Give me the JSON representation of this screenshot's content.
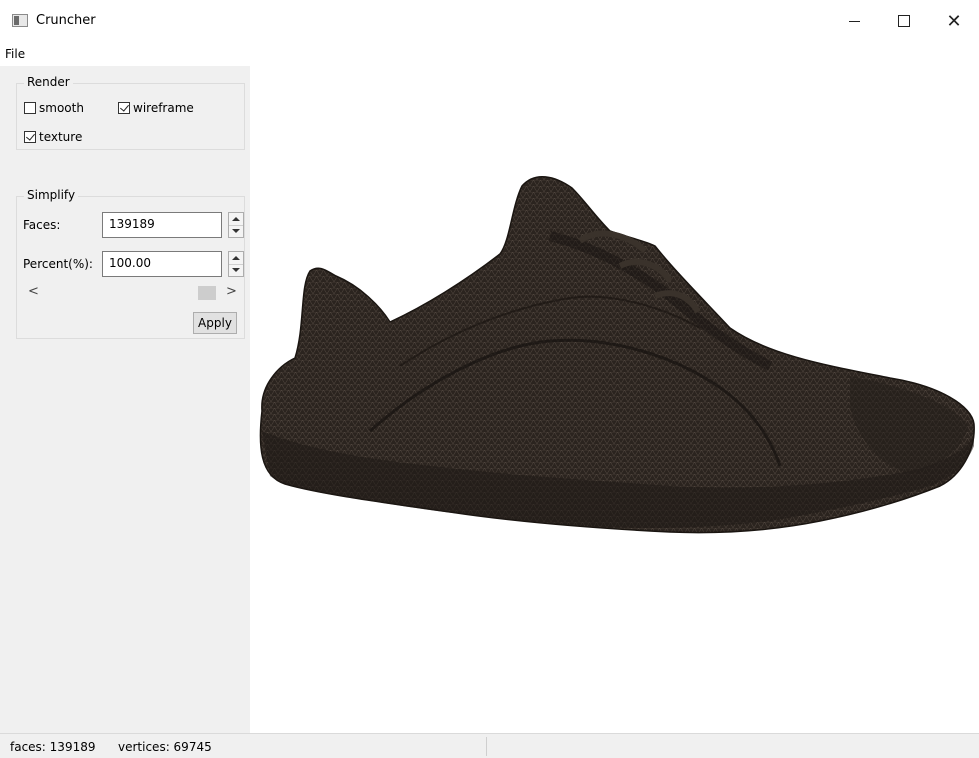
{
  "window": {
    "title": "Cruncher",
    "min_glyph": "",
    "max_glyph": "",
    "close_glyph": "✕"
  },
  "menu": {
    "file": "File"
  },
  "render_group": {
    "title": "Render",
    "smooth": {
      "label": "smooth",
      "checked": false
    },
    "wireframe": {
      "label": "wireframe",
      "checked": true
    },
    "texture": {
      "label": "texture",
      "checked": true
    }
  },
  "simplify_group": {
    "title": "Simplify",
    "faces_label": "Faces:",
    "faces_value": "139189",
    "percent_label": "Percent(%):",
    "percent_value": "100.00",
    "slider_left": "<",
    "slider_right": ">",
    "slider_fraction": 0.9,
    "apply_label": "Apply"
  },
  "viewport": {
    "model": "shoe-mesh",
    "mesh_color": "#2b241f"
  },
  "status": {
    "faces": "faces: 139189",
    "vertices": "vertices: 69745"
  }
}
